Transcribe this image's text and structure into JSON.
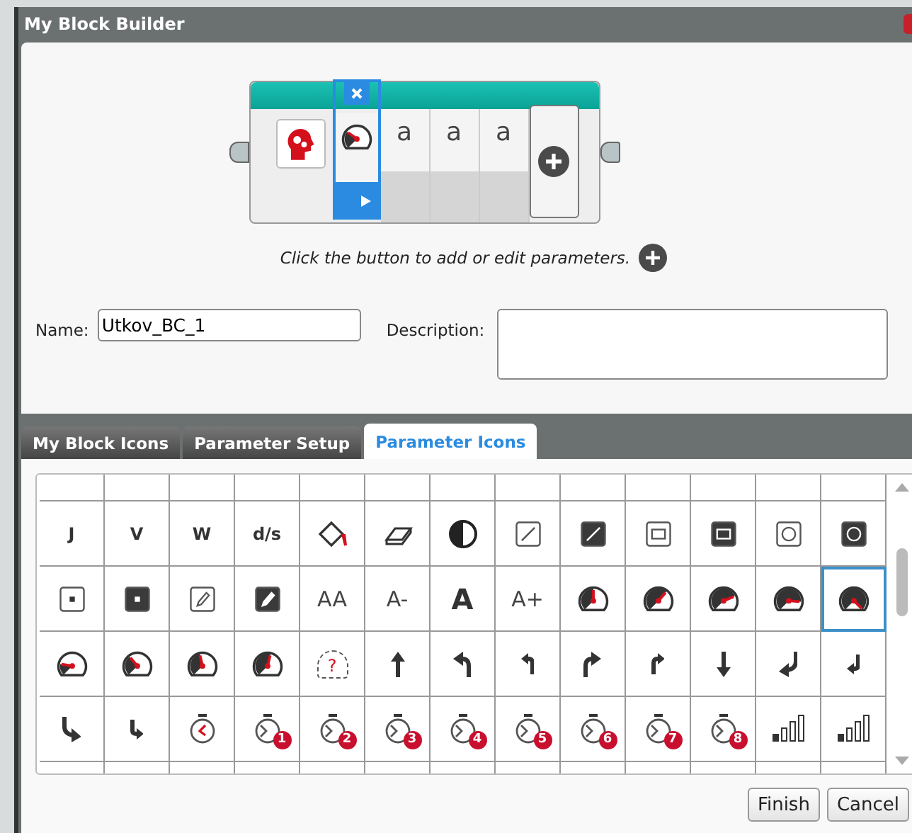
{
  "window": {
    "title": "My Block Builder"
  },
  "block": {
    "params": [
      {
        "kind": "gauge",
        "selected": true
      },
      {
        "kind": "text",
        "text": "a",
        "selected": false
      },
      {
        "kind": "text",
        "text": "a",
        "selected": false
      },
      {
        "kind": "text",
        "text": "a",
        "selected": false
      }
    ]
  },
  "hint": "Click the button to add or edit parameters.",
  "name": {
    "label": "Name:",
    "value": "Utkov_BC_1"
  },
  "description": {
    "label": "Description:"
  },
  "tabs": [
    {
      "label": "My Block Icons",
      "selected": false
    },
    {
      "label": "Parameter Setup",
      "selected": false
    },
    {
      "label": "Parameter Icons",
      "selected": true
    }
  ],
  "grid": {
    "rows": [
      {
        "cells": [
          {
            "kind": "text",
            "text": "J",
            "selected": false
          },
          {
            "kind": "text",
            "text": "V",
            "selected": false
          },
          {
            "kind": "text",
            "text": "W",
            "selected": false
          },
          {
            "kind": "text",
            "text": "d/s",
            "selected": false
          },
          {
            "kind": "bucket",
            "selected": false
          },
          {
            "kind": "eraser",
            "selected": false
          },
          {
            "kind": "contrast",
            "selected": false
          },
          {
            "kind": "slash",
            "filled": false,
            "selected": false
          },
          {
            "kind": "slash",
            "filled": true,
            "selected": false
          },
          {
            "kind": "rect",
            "filled": false,
            "selected": false
          },
          {
            "kind": "rect",
            "filled": true,
            "selected": false
          },
          {
            "kind": "circle",
            "filled": false,
            "selected": false
          },
          {
            "kind": "circle",
            "filled": true,
            "selected": false
          }
        ]
      },
      {
        "cells": [
          {
            "kind": "dot",
            "filled": false,
            "selected": false
          },
          {
            "kind": "dot",
            "filled": true,
            "selected": false
          },
          {
            "kind": "pencil",
            "filled": false,
            "selected": false
          },
          {
            "kind": "pencil",
            "filled": true,
            "selected": false
          },
          {
            "kind": "font",
            "text": "AA",
            "selected": false
          },
          {
            "kind": "font",
            "text": "A-",
            "selected": false
          },
          {
            "kind": "bigfont",
            "text": "A",
            "selected": false
          },
          {
            "kind": "font",
            "text": "A+",
            "selected": false
          },
          {
            "kind": "gauge",
            "selected": false
          },
          {
            "kind": "gauge",
            "selected": false
          },
          {
            "kind": "gauge",
            "selected": false
          },
          {
            "kind": "gauge",
            "selected": false
          },
          {
            "kind": "gauge",
            "selected": true
          }
        ]
      },
      {
        "cells": [
          {
            "kind": "gauge",
            "selected": false
          },
          {
            "kind": "gauge",
            "selected": false
          },
          {
            "kind": "gauge",
            "selected": false
          },
          {
            "kind": "gauge",
            "selected": false
          },
          {
            "kind": "unknown-gauge",
            "text": "?",
            "selected": false
          },
          {
            "kind": "arrow-up",
            "selected": false
          },
          {
            "kind": "arrow-up-left-curve",
            "selected": false
          },
          {
            "kind": "arrow-up-left",
            "selected": false
          },
          {
            "kind": "arrow-up-right-curve",
            "selected": false
          },
          {
            "kind": "arrow-up-right",
            "selected": false
          },
          {
            "kind": "arrow-down",
            "selected": false
          },
          {
            "kind": "arrow-down-left-curve",
            "selected": false
          },
          {
            "kind": "arrow-down-left",
            "selected": false
          }
        ]
      },
      {
        "cells": [
          {
            "kind": "arrow-down-right-curve",
            "selected": false
          },
          {
            "kind": "arrow-down-right",
            "selected": false
          },
          {
            "kind": "timer",
            "selected": false
          },
          {
            "kind": "timer",
            "badge": "1",
            "selected": false
          },
          {
            "kind": "timer",
            "badge": "2",
            "selected": false
          },
          {
            "kind": "timer",
            "badge": "3",
            "selected": false
          },
          {
            "kind": "timer",
            "badge": "4",
            "selected": false
          },
          {
            "kind": "timer",
            "badge": "5",
            "selected": false
          },
          {
            "kind": "timer",
            "badge": "6",
            "selected": false
          },
          {
            "kind": "timer",
            "badge": "7",
            "selected": false
          },
          {
            "kind": "timer",
            "badge": "8",
            "selected": false
          },
          {
            "kind": "bars",
            "level": 0.25,
            "selected": false
          },
          {
            "kind": "bars",
            "level": 0.3,
            "selected": false
          }
        ]
      }
    ]
  },
  "buttons": [
    "Finish",
    "Cancel"
  ]
}
